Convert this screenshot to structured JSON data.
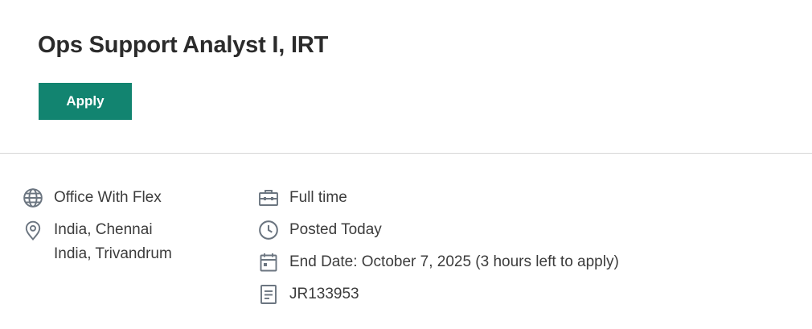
{
  "job": {
    "title": "Ops Support Analyst I, IRT",
    "apply_label": "Apply"
  },
  "details": {
    "work_mode": "Office With Flex",
    "locations": [
      "India, Chennai",
      "India, Trivandrum"
    ],
    "job_type": "Full time",
    "posted": "Posted Today",
    "end_date": "End Date: October 7, 2025 (3 hours left to apply)",
    "requisition_id": "JR133953"
  },
  "colors": {
    "accent": "#128470",
    "icon": "#6b7580"
  },
  "icons": {
    "work_mode": "globe-icon",
    "location": "location-pin-icon",
    "job_type": "briefcase-icon",
    "posted": "clock-icon",
    "end_date": "calendar-icon",
    "requisition_id": "document-icon"
  }
}
